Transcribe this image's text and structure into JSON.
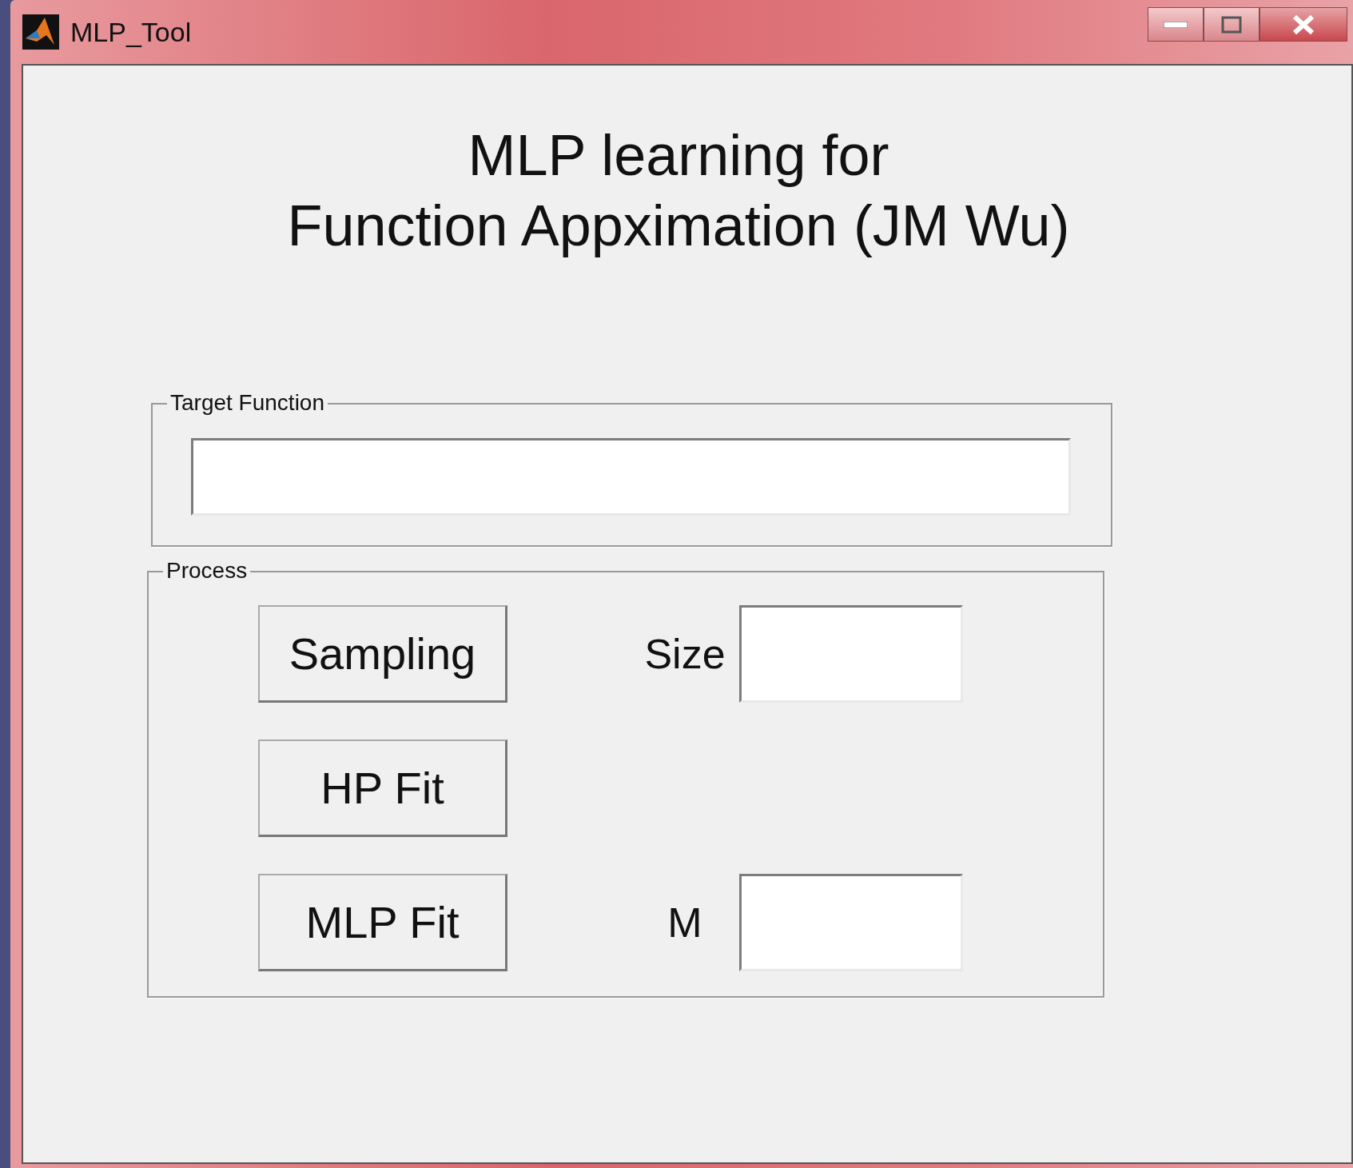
{
  "window": {
    "title": "MLP_Tool"
  },
  "heading": [
    "MLP learning for",
    "Function Appximation (JM Wu)"
  ],
  "target_function": {
    "label": "Target Function"
  },
  "process": {
    "label": "Process",
    "rows": [
      {
        "button": "Sampling",
        "field_label": "Size"
      },
      {
        "button": "HP Fit"
      },
      {
        "button": "MLP Fit",
        "field_label": "M"
      }
    ]
  }
}
